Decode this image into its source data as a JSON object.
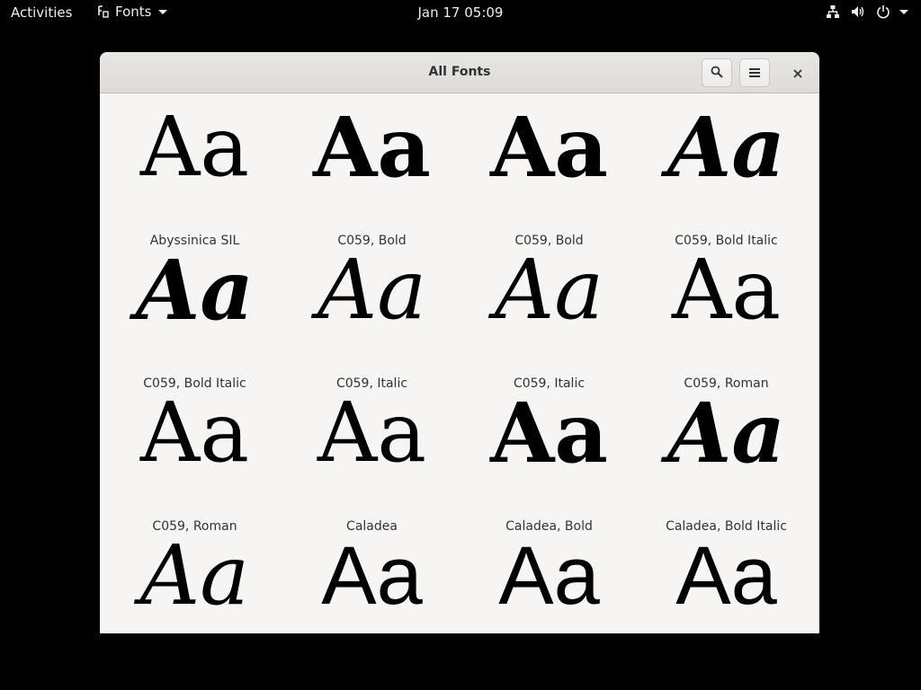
{
  "topbar": {
    "activities_label": "Activities",
    "app_name": "Fonts",
    "clock": "Jan 17  05:09",
    "icons": [
      "network-icon",
      "volume-icon",
      "power-icon"
    ]
  },
  "window": {
    "title": "All Fonts",
    "buttons": {
      "search_icon": "search-icon",
      "menu_icon": "menu-icon",
      "close_icon": "close-icon"
    }
  },
  "fonts": [
    {
      "sample": "Aa",
      "label": "Abyssinica SIL",
      "style": "serif"
    },
    {
      "sample": "Aa",
      "label": "C059, Bold",
      "style": "serif-bold"
    },
    {
      "sample": "Aa",
      "label": "C059, Bold",
      "style": "serif-bold"
    },
    {
      "sample": "Aa",
      "label": "C059, Bold Italic",
      "style": "serif-bold-italic"
    },
    {
      "sample": "Aa",
      "label": "C059, Bold Italic",
      "style": "serif-bold-italic"
    },
    {
      "sample": "Aa",
      "label": "C059, Italic",
      "style": "serif-italic"
    },
    {
      "sample": "Aa",
      "label": "C059, Italic",
      "style": "serif-italic"
    },
    {
      "sample": "Aa",
      "label": "C059, Roman",
      "style": "serif"
    },
    {
      "sample": "Aa",
      "label": "C059, Roman",
      "style": "serif"
    },
    {
      "sample": "Aa",
      "label": "Caladea",
      "style": "serif"
    },
    {
      "sample": "Aa",
      "label": "Caladea, Bold",
      "style": "serif-bold"
    },
    {
      "sample": "Aa",
      "label": "Caladea, Bold Italic",
      "style": "serif-bold-italic"
    },
    {
      "sample": "Aa",
      "label": "",
      "style": "serif-italic"
    },
    {
      "sample": "Aa",
      "label": "",
      "style": "sans"
    },
    {
      "sample": "Aa",
      "label": "",
      "style": "sans"
    },
    {
      "sample": "Aa",
      "label": "",
      "style": "sans"
    }
  ]
}
